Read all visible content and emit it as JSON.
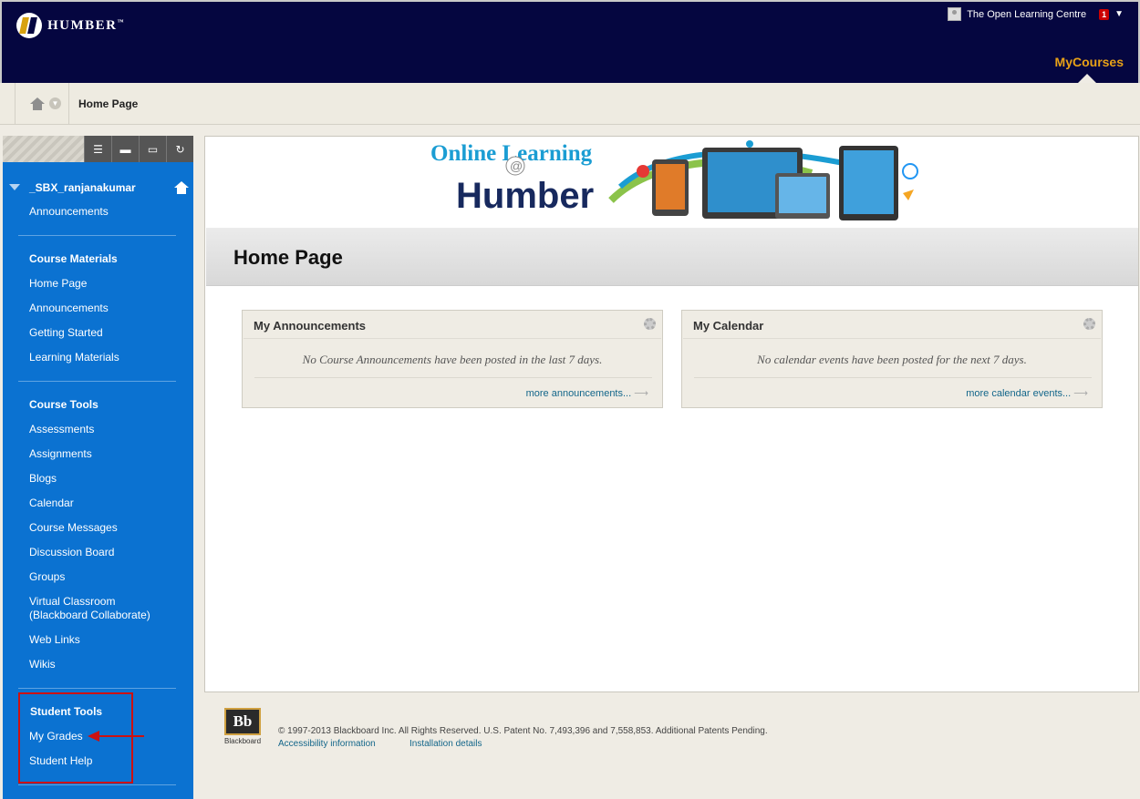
{
  "header": {
    "logo_text": "HUMBER",
    "logo_tm": "™",
    "user_name": "The Open Learning Centre",
    "notification_count": "1",
    "tab": "MyCourses"
  },
  "breadcrumb": {
    "current": "Home Page"
  },
  "sidebar": {
    "course_name": "_SBX_ranjanakumar",
    "top_link": "Announcements",
    "sections": [
      {
        "heading": "Course Materials",
        "items": [
          "Home Page",
          "Announcements",
          "Getting Started",
          "Learning Materials"
        ]
      },
      {
        "heading": "Course Tools",
        "items": [
          "Assessments",
          "Assignments",
          "Blogs",
          "Calendar",
          "Course Messages",
          "Discussion Board",
          "Groups",
          "Virtual Classroom (Blackboard Collaborate)",
          "Web Links",
          "Wikis"
        ]
      },
      {
        "heading": "Student Tools",
        "items": [
          "My Grades",
          "Student Help"
        ]
      }
    ],
    "virtual_classroom_line1": "Virtual Classroom",
    "virtual_classroom_line2": "(Blackboard Collaborate)"
  },
  "banner": {
    "line1": "Online Learning",
    "at": "@",
    "line2": "Humber"
  },
  "main": {
    "page_title": "Home Page",
    "modules": [
      {
        "title": "My Announcements",
        "message": "No Course Announcements have been posted in the last 7 days.",
        "link": "more announcements..."
      },
      {
        "title": "My Calendar",
        "message": "No calendar events have been posted for the next 7 days.",
        "link": "more calendar events..."
      }
    ]
  },
  "footer": {
    "logo_letters": "Bb",
    "logo_word": "Blackboard",
    "copyright": "© 1997-2013 Blackboard Inc. All Rights Reserved. U.S. Patent No. 7,493,396 and 7,558,853. Additional Patents Pending.",
    "accessibility": "Accessibility information",
    "installation": "Installation details"
  },
  "colors": {
    "header_bg": "#050640",
    "accent": "#e8a117",
    "sidebar_bg": "#0b72d1",
    "link": "#13668a",
    "annotation_red": "#cc1111"
  },
  "icons": [
    "home-icon",
    "chevron-down-icon",
    "list-view-icon",
    "folder-view-icon",
    "window-icon",
    "refresh-icon",
    "gear-icon",
    "arrow-right-icon",
    "user-avatar-icon"
  ]
}
